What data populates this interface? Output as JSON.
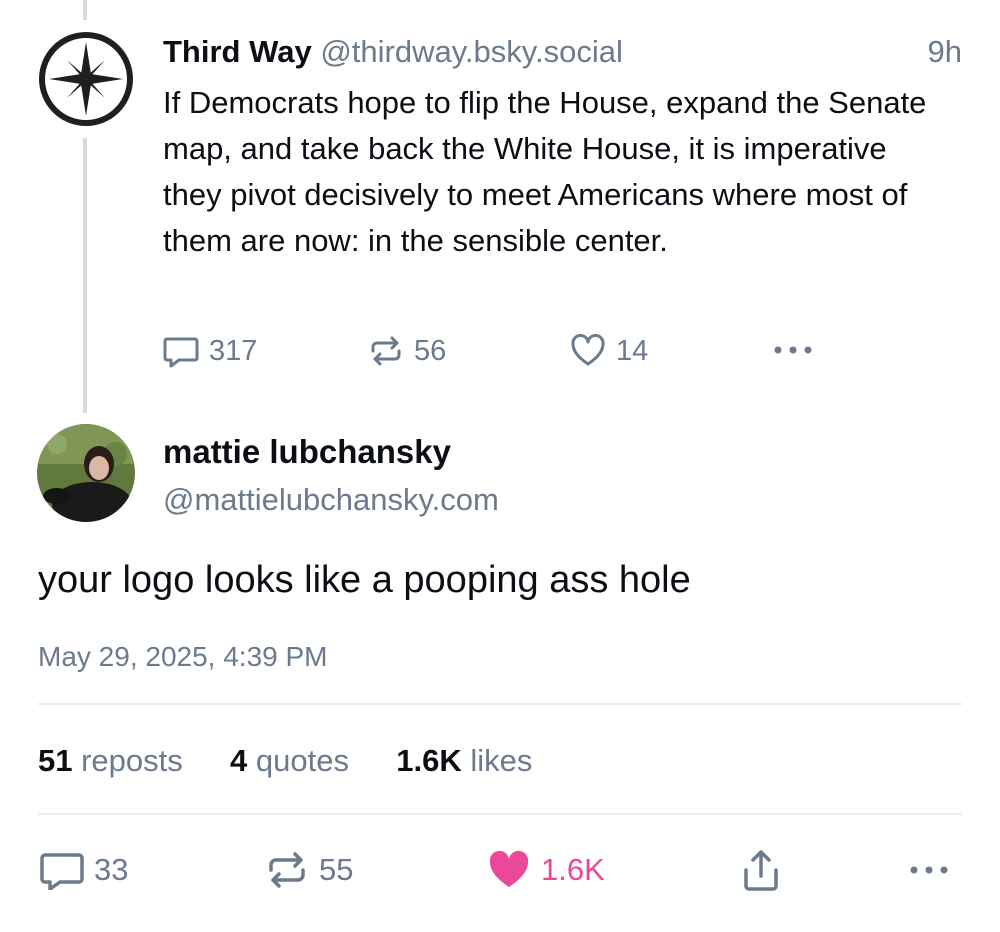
{
  "parent_post": {
    "display_name": "Third Way",
    "handle": "@thirdway.bsky.social",
    "time": "9h",
    "text": "If Democrats hope to flip the House, expand the Senate map, and take back the White House, it is imperative they pivot decisively to meet Americans where most of them are now: in the sensible center.",
    "replies": "317",
    "reposts": "56",
    "likes": "14",
    "avatar_icon": "compass-star-icon"
  },
  "main_post": {
    "display_name": "mattie lubchansky",
    "handle": "@mattielubchansky.com",
    "text": "your logo looks like a pooping ass hole",
    "timestamp": "May 29, 2025, 4:39 PM",
    "stats": {
      "reposts_count": "51",
      "reposts_label": "reposts",
      "quotes_count": "4",
      "quotes_label": "quotes",
      "likes_count": "1.6K",
      "likes_label": "likes"
    },
    "actions": {
      "replies": "33",
      "reposts": "55",
      "likes": "1.6K"
    }
  },
  "colors": {
    "muted": "#6b7a8c",
    "like_active": "#ec4899",
    "thread_line": "#d4dbe2"
  }
}
